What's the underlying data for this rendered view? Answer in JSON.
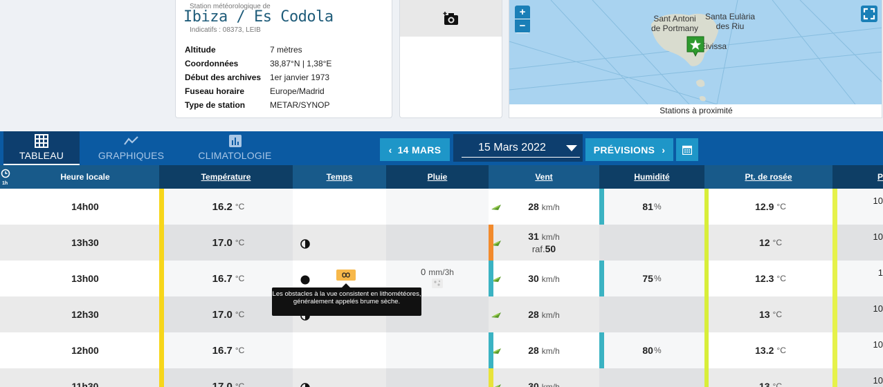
{
  "station": {
    "subtitle": "Station météorologique de",
    "name": "Ibiza / Es Codola",
    "ids": "Indicatifs : 08373, LEIB",
    "fields": [
      {
        "key": "Altitude",
        "value": "7 mètres"
      },
      {
        "key": "Coordonnées",
        "value": "38,87°N | 1,38°E"
      },
      {
        "key": "Début des archives",
        "value": "1er janvier 1973"
      },
      {
        "key": "Fuseau horaire",
        "value": "Europe/Madrid"
      },
      {
        "key": "Type de station",
        "value": "METAR/SYNOP"
      }
    ]
  },
  "map": {
    "zoom_in": "+",
    "zoom_out": "−",
    "labels": {
      "sant_antoni": "Sant Antoni\nde Portmany",
      "santa_eularia": "Santa Eulària\ndes Riu",
      "eivissa": "Eivissa"
    },
    "caption": "Stations à proximité"
  },
  "tabs": [
    {
      "label": "TABLEAU",
      "icon": "grid-icon",
      "active": true
    },
    {
      "label": "GRAPHIQUES",
      "icon": "chart-line-icon",
      "active": false
    },
    {
      "label": "CLIMATOLOGIE",
      "icon": "bar-chart-icon",
      "active": false
    }
  ],
  "date_nav": {
    "prev_label": "14 MARS",
    "current_date": "15 Mars 2022",
    "next_label": "PRÉVISIONS"
  },
  "table": {
    "clock_label": "1h",
    "headers": [
      "Heure locale",
      "Température",
      "Temps",
      "Pluie",
      "Vent",
      "Humidité",
      "Pt. de rosée",
      "P"
    ],
    "rows": [
      {
        "time": "14h00",
        "temp": "16.2",
        "temp_unit": "°C",
        "weather": "",
        "rain": "",
        "wind": "28",
        "wind_unit": "km/h",
        "gust": "",
        "humidity": "81",
        "dew": "12.9",
        "pressure": "10"
      },
      {
        "time": "13h30",
        "temp": "17.0",
        "temp_unit": "°C",
        "weather": "half-moon",
        "rain": "",
        "wind": "31",
        "wind_unit": "km/h",
        "gust_label": "raf.",
        "gust": "50",
        "humidity": "",
        "dew": "12",
        "pressure": "10"
      },
      {
        "time": "13h00",
        "temp": "16.7",
        "temp_unit": "°C",
        "weather": "full-moon",
        "rain": "0",
        "rain_unit": "mm/3h",
        "wind": "30",
        "wind_unit": "km/h",
        "gust": "",
        "humidity": "75",
        "dew": "12.3",
        "pressure": "1"
      },
      {
        "time": "12h30",
        "temp": "17.0",
        "temp_unit": "°C",
        "weather": "half-moon",
        "rain": "",
        "wind": "28",
        "wind_unit": "km/h",
        "gust": "",
        "humidity": "",
        "dew": "13",
        "pressure": "10"
      },
      {
        "time": "12h00",
        "temp": "16.7",
        "temp_unit": "°C",
        "weather": "",
        "rain": "",
        "wind": "28",
        "wind_unit": "km/h",
        "gust": "",
        "humidity": "80",
        "dew": "13.2",
        "pressure": "10"
      },
      {
        "time": "11h30",
        "temp": "17.0",
        "temp_unit": "°C",
        "weather": "half-moon",
        "rain": "",
        "wind": "30",
        "wind_unit": "km/h",
        "gust": "",
        "humidity": "",
        "dew": "13",
        "pressure": "10"
      }
    ],
    "humidity_unit": "%",
    "dew_unit": "°C",
    "tooltip": "Les obstacles à la vue consistent en lithométéores, généralement appelés brume sèche."
  }
}
